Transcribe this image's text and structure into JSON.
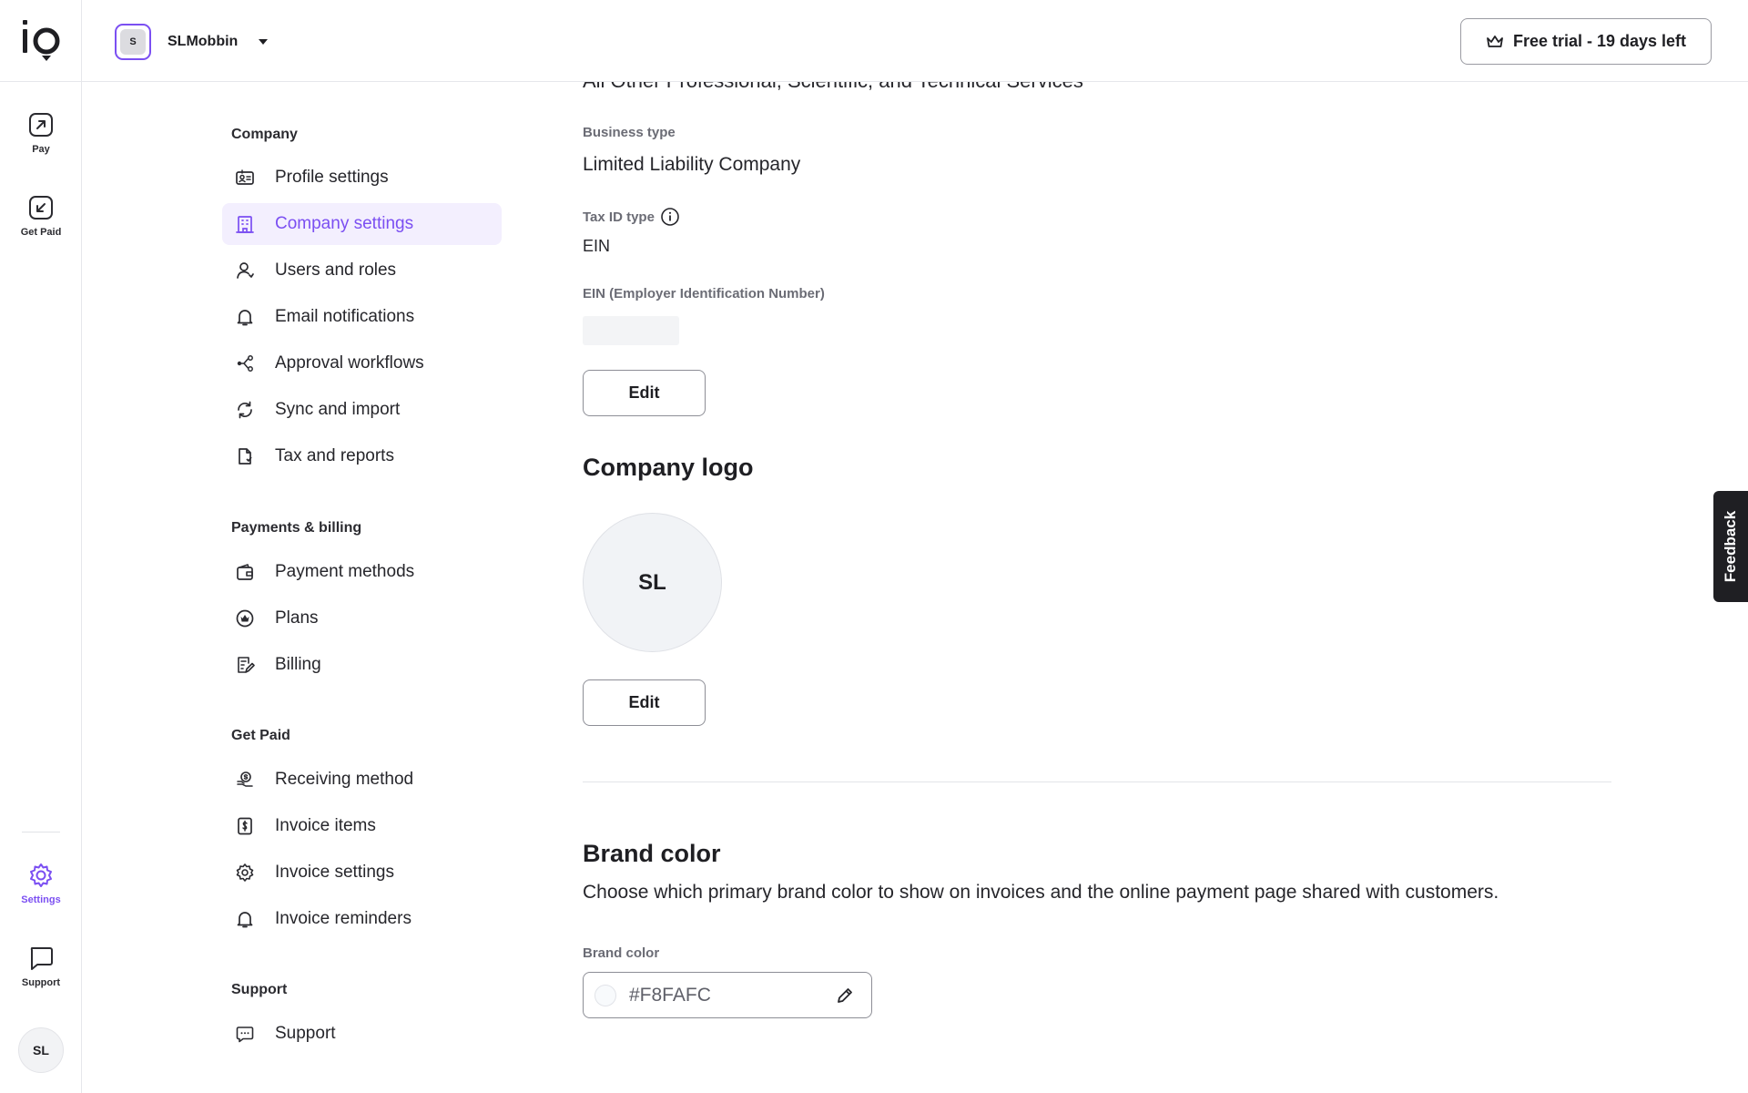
{
  "app": {
    "logo_text": "io"
  },
  "rail": {
    "items": [
      {
        "label": "Pay",
        "icon": "arrow-up-right-square-icon"
      },
      {
        "label": "Get Paid",
        "icon": "arrow-down-left-square-icon"
      },
      {
        "label": "Settings",
        "icon": "gear-icon"
      },
      {
        "label": "Support",
        "icon": "chat-bubble-icon"
      }
    ],
    "avatar_initials": "SL"
  },
  "topbar": {
    "company_initial": "S",
    "company_name": "SLMobbin",
    "trial_label": "Free trial - 19 days left"
  },
  "nav": {
    "groups": [
      {
        "title": "Company",
        "items": [
          {
            "label": "Profile settings",
            "icon": "id-card-icon"
          },
          {
            "label": "Company settings",
            "icon": "building-icon",
            "active": true
          },
          {
            "label": "Users and roles",
            "icon": "user-icon"
          },
          {
            "label": "Email notifications",
            "icon": "bell-icon"
          },
          {
            "label": "Approval workflows",
            "icon": "workflow-icon"
          },
          {
            "label": "Sync and import",
            "icon": "sync-icon"
          },
          {
            "label": "Tax and reports",
            "icon": "document-icon"
          }
        ]
      },
      {
        "title": "Payments & billing",
        "items": [
          {
            "label": "Payment methods",
            "icon": "wallet-icon"
          },
          {
            "label": "Plans",
            "icon": "crown-circle-icon"
          },
          {
            "label": "Billing",
            "icon": "billing-icon"
          }
        ]
      },
      {
        "title": "Get Paid",
        "items": [
          {
            "label": "Receiving method",
            "icon": "receiving-icon"
          },
          {
            "label": "Invoice items",
            "icon": "invoice-dollar-icon"
          },
          {
            "label": "Invoice settings",
            "icon": "gear-icon"
          },
          {
            "label": "Invoice reminders",
            "icon": "bell-icon"
          }
        ]
      },
      {
        "title": "Support",
        "items": [
          {
            "label": "Support",
            "icon": "chat-icon"
          }
        ]
      }
    ]
  },
  "main": {
    "industry_value_clipped": "All Other Professional, Scientific, and Technical Services",
    "business_type_label": "Business type",
    "business_type_value": "Limited Liability Company",
    "tax_id_type_label": "Tax ID type",
    "tax_id_type_value": "EIN",
    "ein_label": "EIN (Employer Identification Number)",
    "edit_label": "Edit",
    "company_logo_title": "Company logo",
    "company_logo_initials": "SL",
    "logo_edit_label": "Edit",
    "brand_color_title": "Brand color",
    "brand_color_desc": "Choose which primary brand color to show on invoices and the online payment page shared with customers.",
    "brand_color_field_label": "Brand color",
    "brand_color_value": "#F8FAFC"
  },
  "feedback_label": "Feedback",
  "colors": {
    "accent": "#7b4ff2",
    "active_bg": "#f3effe",
    "swatch": "#F8FAFC"
  }
}
